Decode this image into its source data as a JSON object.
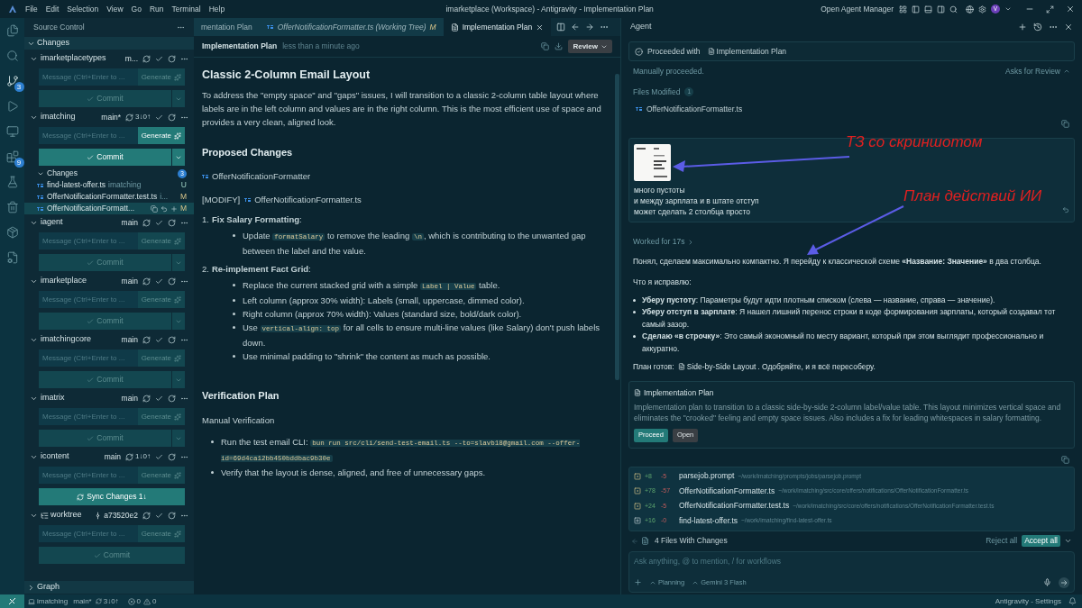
{
  "menu": [
    "File",
    "Edit",
    "Selection",
    "View",
    "Go",
    "Run",
    "Terminal",
    "Help"
  ],
  "window_title": "imarketplace (Workspace) - Antigravity - Implementation Plan",
  "title_bar": {
    "agent_manager": "Open Agent Manager",
    "avatar": "V"
  },
  "activity_bar": [
    {
      "kind": "files",
      "selected": false
    },
    {
      "kind": "search",
      "selected": false
    },
    {
      "kind": "source-control",
      "selected": true,
      "badge": "3"
    },
    {
      "kind": "run",
      "selected": false
    },
    {
      "kind": "remote",
      "selected": false
    },
    {
      "kind": "extensions",
      "selected": false,
      "badge": "9"
    },
    {
      "kind": "testing",
      "selected": false
    },
    {
      "kind": "deploy",
      "selected": false
    },
    {
      "kind": "containers",
      "selected": false
    },
    {
      "kind": "reports",
      "selected": false
    }
  ],
  "sidebar": {
    "title": "Source Control",
    "section": "Changes",
    "graph": "Graph",
    "repos": [
      {
        "kind": "repo",
        "name": "imarketplacetypes",
        "branch": "m...",
        "active": false,
        "placeholder": "Message (Ctrl+Enter to ...",
        "generate": "Generate",
        "action": {
          "kind": "commit",
          "label": "Commit",
          "split": true
        }
      },
      {
        "kind": "repo",
        "name": "imatching",
        "branch": "main*",
        "sync": "3↓0↑",
        "active": true,
        "placeholder": "Message (Ctrl+Enter to ...",
        "generate": "Generate",
        "action": {
          "kind": "commit",
          "label": "Commit",
          "split": true
        },
        "changes": {
          "label": "Changes",
          "count": "3",
          "files": [
            {
              "name": "find-latest-offer.ts",
              "folder": "imatching",
              "status": "U",
              "kind": "untracked",
              "selected": false
            },
            {
              "name": "OfferNotificationFormatter.test.ts",
              "folder": "i...",
              "status": "M",
              "kind": "modified",
              "selected": false
            },
            {
              "name": "OfferNotificationFormatt...",
              "status": "M",
              "kind": "modified",
              "selected": true
            }
          ]
        }
      },
      {
        "kind": "repo",
        "name": "iagent",
        "branch": "main",
        "active": false,
        "placeholder": "Message (Ctrl+Enter to ...",
        "generate": "Generate",
        "action": {
          "kind": "commit",
          "label": "Commit",
          "split": true
        }
      },
      {
        "kind": "repo",
        "name": "imarketplace",
        "branch": "main",
        "active": false,
        "placeholder": "Message (Ctrl+Enter to ...",
        "generate": "Generate",
        "action": {
          "kind": "commit",
          "label": "Commit",
          "split": true
        }
      },
      {
        "kind": "repo",
        "name": "imatchingcore",
        "branch": "main",
        "active": false,
        "placeholder": "Message (Ctrl+Enter to ...",
        "generate": "Generate",
        "action": {
          "kind": "commit",
          "label": "Commit",
          "split": true
        }
      },
      {
        "kind": "repo",
        "name": "imatrix",
        "branch": "main",
        "active": false,
        "placeholder": "Message (Ctrl+Enter to ...",
        "generate": "Generate",
        "action": {
          "kind": "commit",
          "label": "Commit",
          "split": true
        }
      },
      {
        "kind": "repo",
        "name": "icontent",
        "branch": "main",
        "sync": "1↓0↑",
        "active": false,
        "placeholder": "Message (Ctrl+Enter to ...",
        "generate": "Generate",
        "action": {
          "kind": "sync",
          "label": "Sync Changes 1↓",
          "split": false
        }
      },
      {
        "kind": "worktree",
        "name": "worktree",
        "branch": "a73520e2",
        "active": false,
        "placeholder": "Message (Ctrl+Enter to ...",
        "generate": "Generate",
        "action": {
          "kind": "commit",
          "label": "Commit",
          "split": false
        }
      }
    ]
  },
  "tabs": [
    {
      "label": "mentation Plan",
      "kind": "doc",
      "selected": false
    },
    {
      "label": "OfferNotificationFormatter.ts (Working Tree)",
      "status": "M",
      "kind": "ts",
      "selected": false
    },
    {
      "label": "Implementation Plan",
      "kind": "doc",
      "selected": true
    }
  ],
  "doc": {
    "title": "Implementation Plan",
    "time": "less than a minute ago",
    "review": "Review",
    "heading": "Classic 2-Column Email Layout",
    "intro": "To address the \"empty space\" and \"gaps\" issues, I will transition to a classic 2-column table layout where labels are in the left column and values are in the right column. This is the most efficient use of space and provides a very clean, aligned look.",
    "changes_heading": "Proposed Changes",
    "component": "OfferNotificationFormatter",
    "modify_tag": "[MODIFY]",
    "modify_file": "OfferNotificationFormatter.ts",
    "steps": [
      {
        "number": "1.",
        "title": "**Fix Salary Formatting**:",
        "bullets": [
          [
            {
              "kind": "text",
              "text": "Update "
            },
            {
              "kind": "code",
              "text": "formatSalary"
            },
            {
              "kind": "text",
              "text": " to remove the leading "
            },
            {
              "kind": "code",
              "text": "\\n"
            },
            {
              "kind": "text",
              "text": ", which is contributing to the unwanted gap between the label and the value."
            }
          ]
        ]
      },
      {
        "number": "2.",
        "title": "**Re-implement Fact Grid**:",
        "bullets": [
          [
            {
              "kind": "text",
              "text": "Replace the current stacked grid with a simple "
            },
            {
              "kind": "code",
              "text": "Label | Value"
            },
            {
              "kind": "text",
              "text": " table."
            }
          ],
          [
            {
              "kind": "text",
              "text": "Left column (approx 30% width): Labels (small, uppercase, dimmed color)."
            }
          ],
          [
            {
              "kind": "text",
              "text": "Right column (approx 70% width): Values (standard size, bold/dark color)."
            }
          ],
          [
            {
              "kind": "text",
              "text": "Use "
            },
            {
              "kind": "code",
              "text": "vertical-align: top"
            },
            {
              "kind": "text",
              "text": " for all cells to ensure multi-line values (like Salary) don't push labels down."
            }
          ],
          [
            {
              "kind": "text",
              "text": "Use minimal padding to \"shrink\" the content as much as possible."
            }
          ]
        ]
      }
    ],
    "verify_heading": "Verification Plan",
    "manual": "Manual Verification",
    "verify_bullets": [
      [
        {
          "kind": "text",
          "text": "Run the test email CLI: "
        },
        {
          "kind": "code",
          "text": "bun run src/cli/send-test-email.ts --to=slavb18@gmail.com --offer-id=69d4ca12bb450bddbac9b30e"
        }
      ],
      [
        {
          "kind": "text",
          "text": "Verify that the layout is dense, aligned, and free of unnecessary gaps."
        }
      ]
    ]
  },
  "agent": {
    "title": "Agent",
    "proceeded": "Proceeded with",
    "proceeded_doc": "Implementation Plan",
    "manual": "Manually proceeded.",
    "asks": "Asks for Review",
    "files_modified": "Files Modified",
    "files_count": "1",
    "modified_file": "OfferNotificationFormatter.ts",
    "user_message": [
      "много пустоты",
      "и между зарплата и в штате отступ",
      "может сделать 2 столбца просто"
    ],
    "worked": "Worked for 17s",
    "reply": "Понял, сделаем максимально компактно. Я перейду к классической схеме **«Название: Значение»** в два столбца.",
    "fix_heading": "Что я исправлю:",
    "fixes": [
      "**Уберу пустоту**: Параметры будут идти плотным списком (слева — название, справа — значение).",
      "**Уберу отступ в зарплате**: Я нашел лишний перенос строки в коде формирования зарплаты, который создавал тот самый зазор.",
      "**Сделаю «в строчку»**: Это самый экономный по месту вариант, который при этом выглядит профессионально и аккуратно."
    ],
    "plan_ready": "План готов:",
    "plan_link": "Side-by-Side Layout",
    "plan_after": ". Одобряйте, и я всё пересоберу.",
    "plan_card": {
      "title": "Implementation Plan",
      "description": "Implementation plan to transition to a classic side-by-side 2-column label/value table. This layout minimizes vertical space and eliminates the \"crooked\" feeling and empty space issues. Also includes a fix for leading whitespaces in salary formatting.",
      "proceed": "Proceed",
      "open": "Open"
    },
    "changed_files": [
      {
        "kind": "modified",
        "added": "+8",
        "removed": "-5",
        "name": "parsejob.prompt",
        "path": "~/work/imatching/prompts/jobs/parsejob.prompt"
      },
      {
        "kind": "modified",
        "added": "+78",
        "removed": "-57",
        "name": "OfferNotificationFormatter.ts",
        "path": "~/work/imatching/src/core/offers/notifications/OfferNotificationFormatter.ts"
      },
      {
        "kind": "modified",
        "added": "+24",
        "removed": "-5",
        "name": "OfferNotificationFormatter.test.ts",
        "path": "~/work/imatching/src/core/offers/notifications/OfferNotificationFormatter.test.ts"
      },
      {
        "kind": "added",
        "added": "+16",
        "removed": "-0",
        "name": "find-latest-offer.ts",
        "path": "~/work/imatching/find-latest-offer.ts"
      }
    ],
    "files_summary": "4 Files With Changes",
    "reject": "Reject all",
    "accept": "Accept all",
    "input_placeholder": "Ask anything, @ to mention, / for workflows",
    "mode": "Planning",
    "model": "Gemini 3 Flash"
  },
  "annotations": [
    "ТЗ со скриншотом",
    "План действий ИИ"
  ],
  "status_bar": {
    "repo": "imatching",
    "branch": "main*",
    "sync": "3↓0↑",
    "errors": "0",
    "warnings": "0",
    "right": "Antigravity - Settings"
  }
}
